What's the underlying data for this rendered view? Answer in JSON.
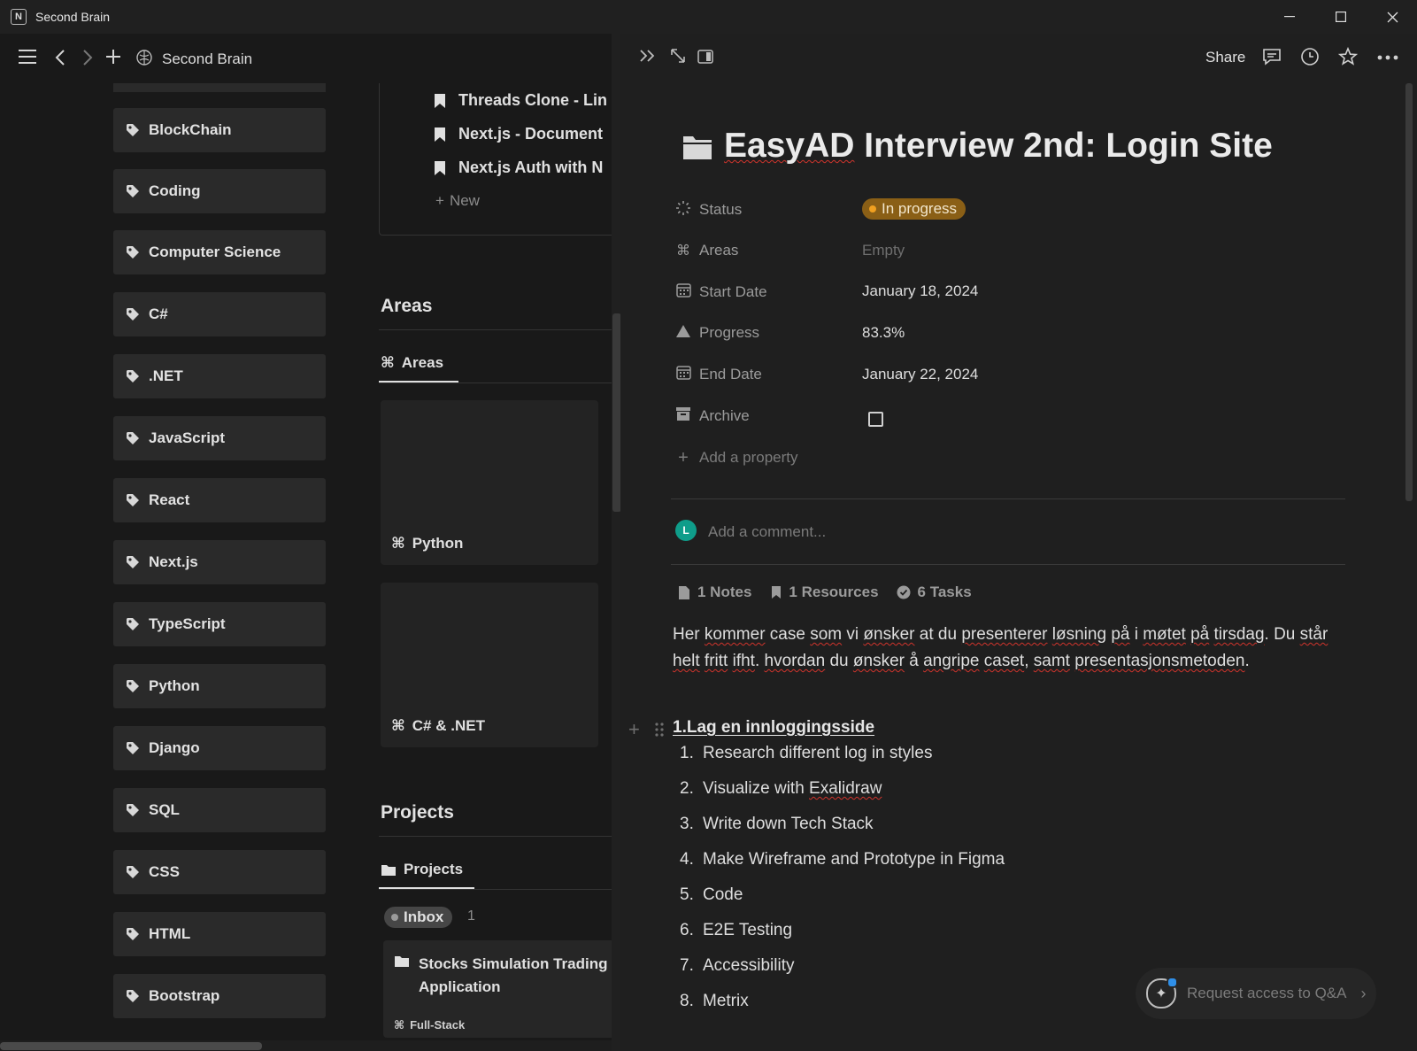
{
  "window": {
    "title": "Second Brain",
    "app_icon": "N"
  },
  "topbar": {
    "breadcrumb_title": "Second Brain"
  },
  "sidebar_tags": [
    "BlockChain",
    "Coding",
    "Computer Science",
    "C#",
    ".NET",
    "JavaScript",
    "React",
    "Next.js",
    "TypeScript",
    "Python",
    "Django",
    "SQL",
    "CSS",
    "HTML",
    "Bootstrap"
  ],
  "resources": {
    "items": [
      "Threads Clone - Lin",
      "Next.js - Document",
      "Next.js Auth with N"
    ],
    "new_label": "New"
  },
  "areas": {
    "title": "Areas",
    "tab_label": "Areas",
    "cards": [
      "Python",
      "C# & .NET"
    ]
  },
  "projects": {
    "title": "Projects",
    "tab_label": "Projects",
    "group_label": "Inbox",
    "group_count": "1",
    "card_title": "Stocks Simulation Trading W Application",
    "card_sub": "Full-Stack"
  },
  "page_header": {
    "share_label": "Share"
  },
  "page": {
    "title_first_word": "EasyAD",
    "title_rest": " Interview 2nd: Login Site",
    "properties": {
      "status_label": "Status",
      "status_value": "In progress",
      "areas_label": "Areas",
      "areas_value": "Empty",
      "start_label": "Start Date",
      "start_value": "January 18, 2024",
      "progress_label": "Progress",
      "progress_value": "83.3%",
      "end_label": "End Date",
      "end_value": "January 22, 2024",
      "archive_label": "Archive"
    },
    "add_property": "Add a property",
    "avatar_letter": "L",
    "comment_placeholder": "Add a comment...",
    "counts": {
      "notes": "1 Notes",
      "resources": "1 Resources",
      "tasks": "6 Tasks"
    },
    "heading": "1.Lag en innloggingsside",
    "steps": [
      "Research different log in styles",
      "Visualize with Exalidraw",
      "Write down Tech Stack",
      "Make Wireframe and Prototype in Figma",
      "Code",
      "E2E Testing",
      "Accessibility",
      "Metrix"
    ]
  },
  "qa_button": {
    "label": "Request access to Q&A"
  },
  "colors": {
    "status_pill_bg": "#a8741c",
    "status_dot": "#f0a020",
    "avatar_bg": "#0f9d8a",
    "background": "#191919",
    "page_bg": "#1f1f1f"
  }
}
